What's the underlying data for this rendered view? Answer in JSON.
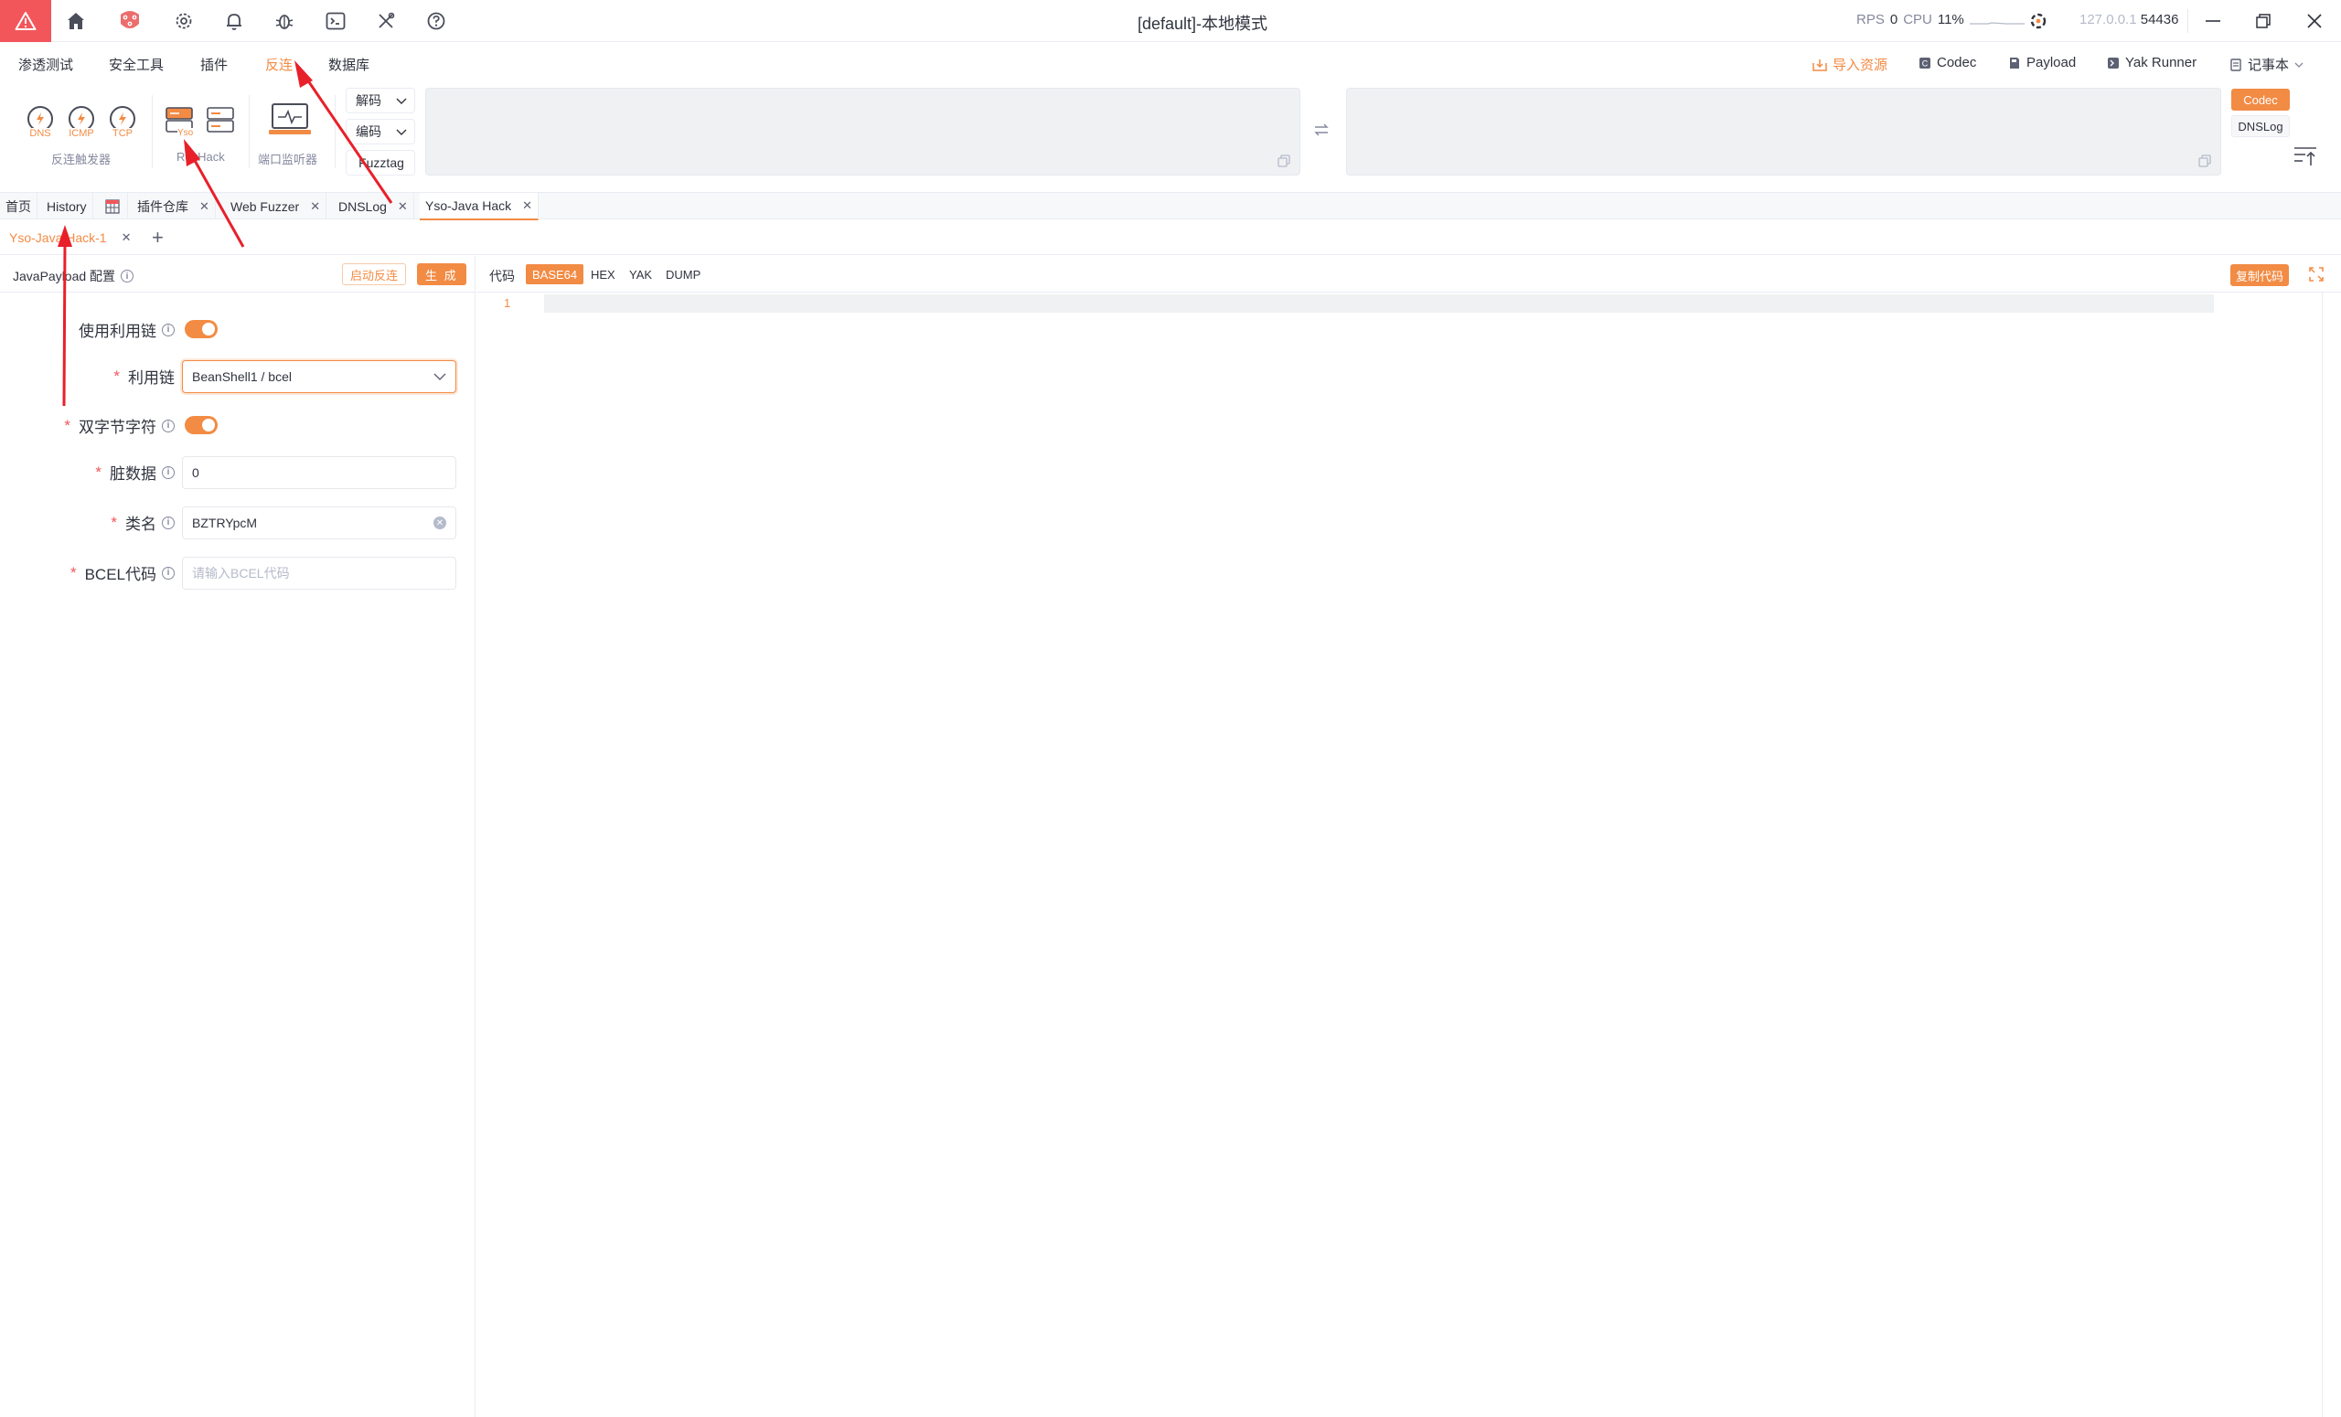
{
  "window": {
    "title": "[default]-本地模式",
    "rps_label": "RPS",
    "rps_value": "0",
    "cpu_label": "CPU",
    "cpu_value": "11%",
    "address": "127.0.0.1",
    "port": "54436"
  },
  "menu": {
    "items": [
      "渗透测试",
      "安全工具",
      "插件",
      "反连",
      "数据库"
    ],
    "active": "反连",
    "quick_links": {
      "import": "导入资源",
      "codec": "Codec",
      "payload": "Payload",
      "yak_runner": "Yak Runner",
      "notepad": "记事本"
    }
  },
  "ribbon": {
    "triggers": [
      "DNS",
      "ICMP",
      "TCP"
    ],
    "trigger_group_label": "反连触发器",
    "yso_label": "Yso",
    "revhack_group_label": "RevHack",
    "port_monitor_label": "端口监听器",
    "decode_label": "解码",
    "encode_label": "编码",
    "fuzztag_label": "Fuzztag",
    "side_tabs": [
      "Codec",
      "DNSLog"
    ],
    "side_active": "Codec"
  },
  "main_tabs": [
    {
      "label": "首页",
      "closable": false
    },
    {
      "label": "History",
      "closable": false
    },
    {
      "label": "插件仓库",
      "closable": true
    },
    {
      "label": "Web Fuzzer",
      "closable": true
    },
    {
      "label": "DNSLog",
      "closable": true
    },
    {
      "label": "Yso-Java Hack",
      "closable": true,
      "active": true
    }
  ],
  "sub_tab": {
    "label": "Yso-Java Hack-1"
  },
  "config": {
    "title": "JavaPayload 配置",
    "start_reverse_btn": "启动反连",
    "generate_btn": "生 成",
    "fields": {
      "use_chain": {
        "label": "使用利用链",
        "value": true
      },
      "chain": {
        "label": "利用链",
        "value": "BeanShell1 / bcel"
      },
      "double_byte": {
        "label": "双字节字符",
        "value": true
      },
      "dirty_data": {
        "label": "脏数据",
        "value": "0"
      },
      "class_name": {
        "label": "类名",
        "value": "BZTRYpcM"
      },
      "bcel_code": {
        "label": "BCEL代码",
        "placeholder": "请输入BCEL代码"
      }
    }
  },
  "code": {
    "label": "代码",
    "formats": [
      "BASE64",
      "HEX",
      "YAK",
      "DUMP"
    ],
    "active_format": "BASE64",
    "copy_btn": "复制代码",
    "line_number": "1"
  },
  "colors": {
    "accent": "#f28b44",
    "danger": "#f2565b",
    "annotation": "#e8202a"
  }
}
